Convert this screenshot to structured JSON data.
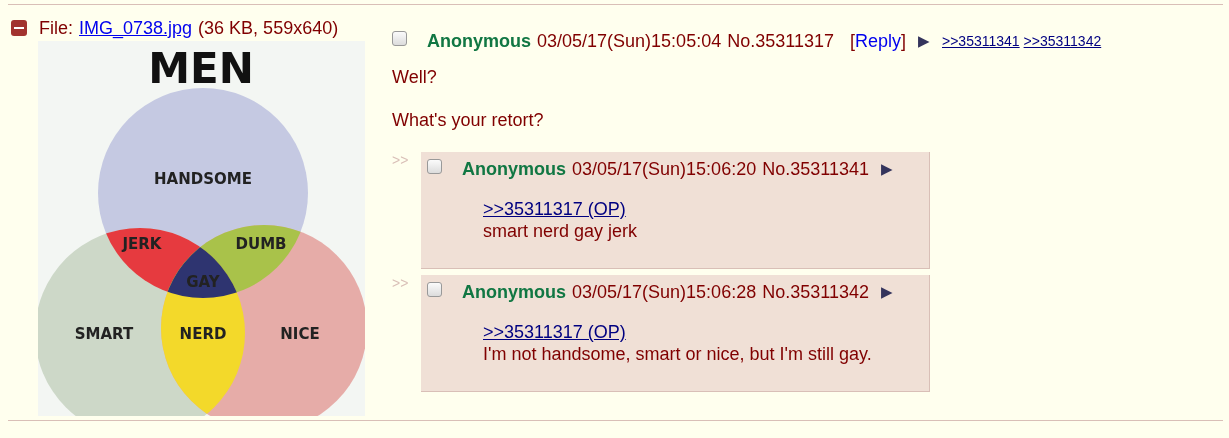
{
  "file": {
    "label": "File:",
    "name": "IMG_0738.jpg",
    "info": "(36 KB, 559x640)"
  },
  "thumbnail": {
    "title": "MEN",
    "labels": [
      {
        "text": "HANDSOME"
      },
      {
        "text": "JERK"
      },
      {
        "text": "DUMB"
      },
      {
        "text": "GAY"
      },
      {
        "text": "SMART"
      },
      {
        "text": "NERD"
      },
      {
        "text": "NICE"
      }
    ]
  },
  "op": {
    "checked": false,
    "name": "Anonymous",
    "datetime": "03/05/17(Sun)15:05:04",
    "number": "No.35311317",
    "reply_open": "[",
    "reply": "Reply",
    "reply_close": "]",
    "menu": "▶",
    "backlinks": [
      ">>35311341",
      ">>35311342"
    ],
    "message": [
      "Well?",
      "What's your retort?"
    ]
  },
  "replies": [
    {
      "marker": ">>",
      "checked": false,
      "name": "Anonymous",
      "datetime": "03/05/17(Sun)15:06:20",
      "number": "No.35311341",
      "menu": "▶",
      "quote": ">>35311317 (OP)",
      "message": "smart nerd gay jerk"
    },
    {
      "marker": ">>",
      "checked": false,
      "name": "Anonymous",
      "datetime": "03/05/17(Sun)15:06:28",
      "number": "No.35311342",
      "menu": "▶",
      "quote": ">>35311317 (OP)",
      "message": "I'm not handsome, smart or nice, but I'm still gay."
    }
  ]
}
